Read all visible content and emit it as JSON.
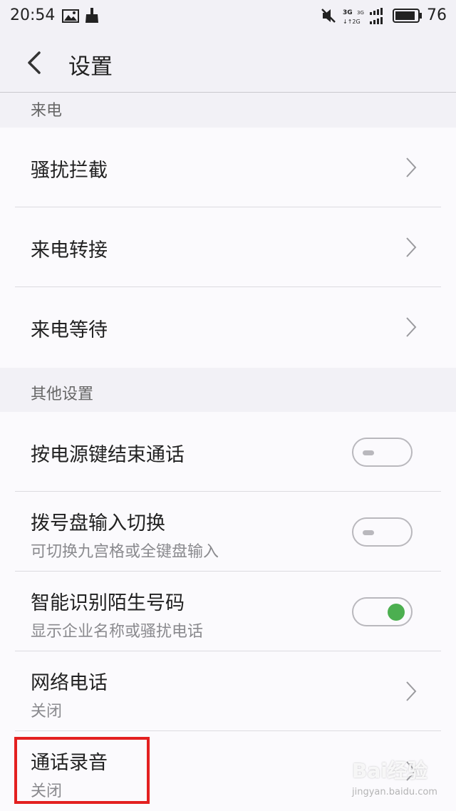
{
  "status_bar": {
    "time": "20:54",
    "battery": "76",
    "network_top": "3G 3G",
    "network_bottom": "2G"
  },
  "header": {
    "title": "设置"
  },
  "sections": [
    {
      "title": "来电",
      "items": [
        {
          "title": "骚扰拦截",
          "control": "chevron"
        },
        {
          "title": "来电转接",
          "control": "chevron"
        },
        {
          "title": "来电等待",
          "control": "chevron"
        }
      ]
    },
    {
      "title": "其他设置",
      "items": [
        {
          "title": "按电源键结束通话",
          "control": "toggle",
          "on": false
        },
        {
          "title": "拨号盘输入切换",
          "subtitle": "可切换九宫格或全键盘输入",
          "control": "toggle",
          "on": false
        },
        {
          "title": "智能识别陌生号码",
          "subtitle": "显示企业名称或骚扰电话",
          "control": "toggle",
          "on": true
        },
        {
          "title": "网络电话",
          "subtitle": "关闭",
          "control": "chevron"
        },
        {
          "title": "通话录音",
          "subtitle": "关闭",
          "control": "chevron"
        }
      ]
    }
  ],
  "watermark": {
    "brand": "Bai经验",
    "url": "jingyan.baidu.com"
  },
  "colors": {
    "toggle_on": "#4caf50",
    "highlight": "#e32020"
  }
}
